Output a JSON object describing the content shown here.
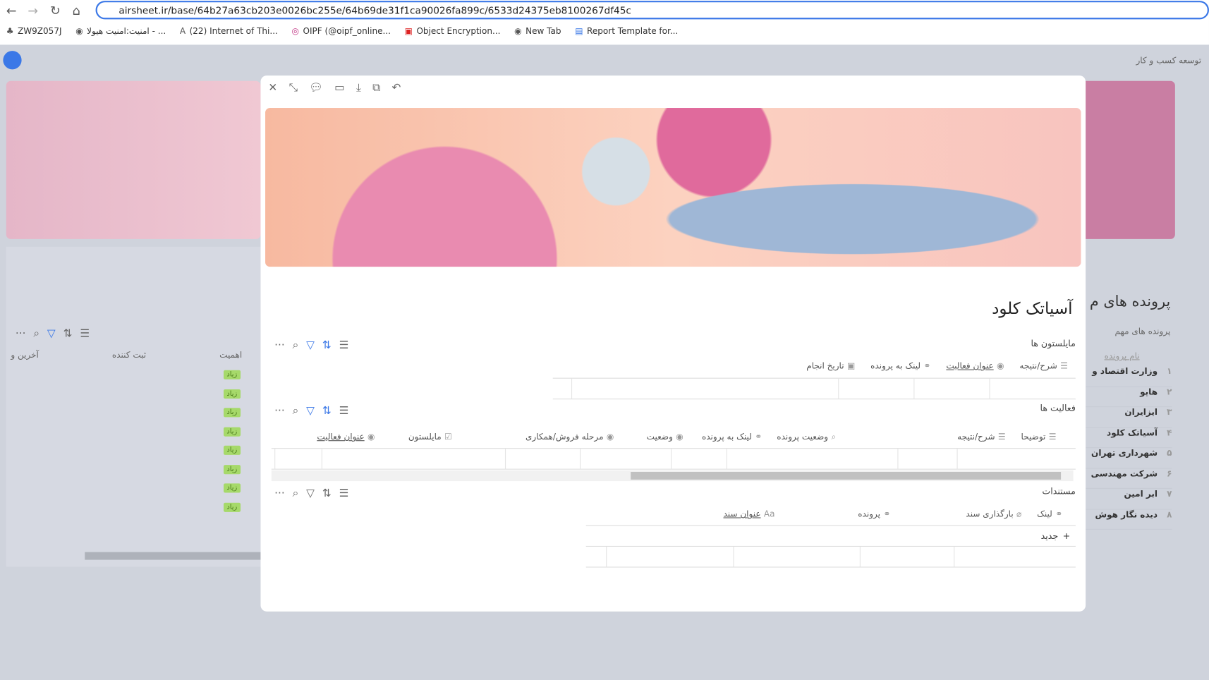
{
  "browser": {
    "url": "airsheet.ir/base/64b27a63cb203e0026bc255e/64b69de31f1ca90026fa899c/6533d24375eb8100267df45c",
    "bookmarks": [
      "ZW9Z057J",
      "امنیت:امنیت هیولا - ...",
      "(22) Internet of Thi...",
      "OIPF (@oipf_online...",
      "Object Encryption...",
      "New Tab",
      "Report Template for..."
    ]
  },
  "background": {
    "breadcrumb": "توسعه کسب و کار",
    "page_title": "پرونده های م",
    "view_label": "پرونده های مهم",
    "col_name": "نام پرونده",
    "left_headers": [
      "اهمیت",
      "ثبت کننده",
      "آخرین و"
    ],
    "tag": "زیاد",
    "rows": [
      {
        "n": "۱",
        "name": "وزارت اقتصاد و"
      },
      {
        "n": "۲",
        "name": "هایو"
      },
      {
        "n": "۳",
        "name": "ایزایران"
      },
      {
        "n": "۴",
        "name": "آسیاتک کلود"
      },
      {
        "n": "۵",
        "name": "شهرداری تهران"
      },
      {
        "n": "۶",
        "name": "شرکت مهندسی"
      },
      {
        "n": "۷",
        "name": "ابر امین"
      },
      {
        "n": "۸",
        "name": "دیده نگار هوش"
      }
    ]
  },
  "record": {
    "title": "آسیاتک کلود",
    "milestones": {
      "label": "مایلستون ها",
      "headers": [
        "تاریخ انجام",
        "لینک به پرونده",
        "عنوان فعالیت",
        "شرح/نتیجه"
      ]
    },
    "activities": {
      "label": "فعالیت ها",
      "headers": [
        "عنوان فعالیت",
        "مایلستون",
        "مرحله فروش/همکاری",
        "وضعیت",
        "لینک به پرونده",
        "وضعیت پرونده",
        "شرح/نتیجه",
        "توضیحا"
      ]
    },
    "documents": {
      "label": "مستندات",
      "headers": [
        "عنوان سند",
        "پرونده",
        "بارگذاری سند",
        "لینک"
      ],
      "new_label": "جدید"
    }
  }
}
